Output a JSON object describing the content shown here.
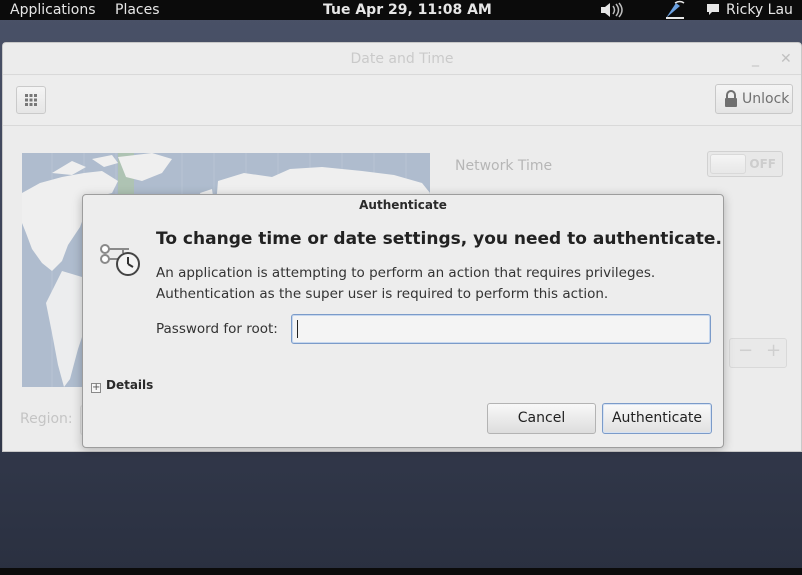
{
  "top_panel": {
    "applications": "Applications",
    "places": "Places",
    "clock": "Tue Apr 29, 11:08 AM",
    "user": "Ricky Lau"
  },
  "window": {
    "title": "Date and Time",
    "minimize": "_",
    "close": "✕",
    "unlock_label": "Unlock",
    "network_time_label": "Network Time",
    "network_time_state": "OFF",
    "stepper_minus": "−",
    "stepper_plus": "+",
    "region_label": "Region:"
  },
  "dialog": {
    "title": "Authenticate",
    "heading": "To change time or date settings, you need to authenticate.",
    "body_line1": "An application is attempting to perform an action that requires privileges.",
    "body_line2": "Authentication as the super user is required to perform this action.",
    "password_label": "Password for root:",
    "password_value": "",
    "expander_symbol": "+",
    "details_label": "Details",
    "cancel_label": "Cancel",
    "authenticate_label": "Authenticate"
  },
  "colors": {
    "panel_bg": "#0b0b0b",
    "window_bg": "#ededed",
    "map_ocean": "#8fa4bf",
    "map_land": "#f2f2f2",
    "timezone_highlight": "#8bc34a",
    "focus_border": "#7b9bc9"
  },
  "icons": {
    "volume": "volume-icon",
    "network": "network-icon",
    "chat": "chat-icon",
    "grid": "app-grid-icon",
    "lock": "lock-icon",
    "auth": "keys-clock-icon"
  }
}
